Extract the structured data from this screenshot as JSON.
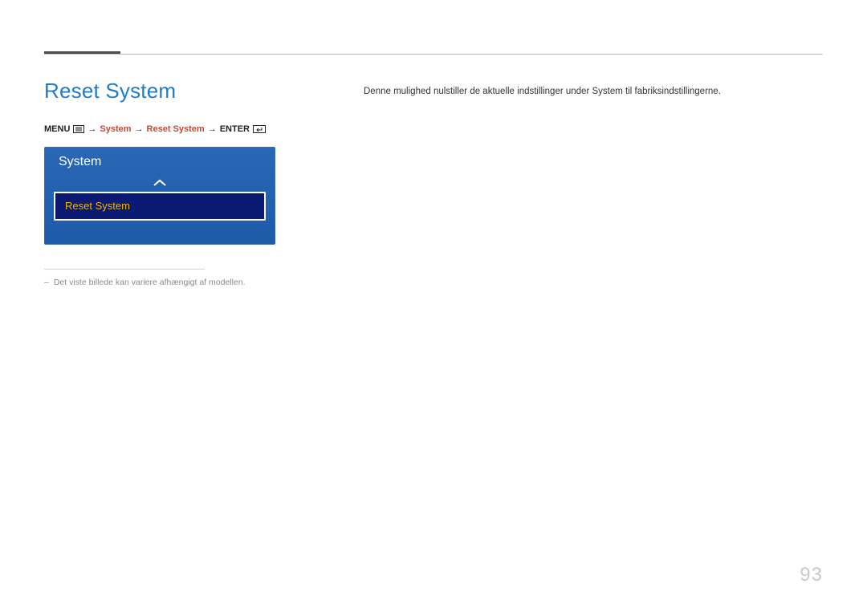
{
  "heading": "Reset System",
  "breadcrumb": {
    "menu": "MENU",
    "system": "System",
    "reset_system": "Reset System",
    "enter": "ENTER"
  },
  "osd": {
    "title": "System",
    "selected_item": "Reset System"
  },
  "note": {
    "text": "Det viste billede kan variere afhængigt af modellen."
  },
  "description": "Denne mulighed nulstiller de aktuelle indstillinger under System til fabriksindstillingerne.",
  "page_number": "93"
}
